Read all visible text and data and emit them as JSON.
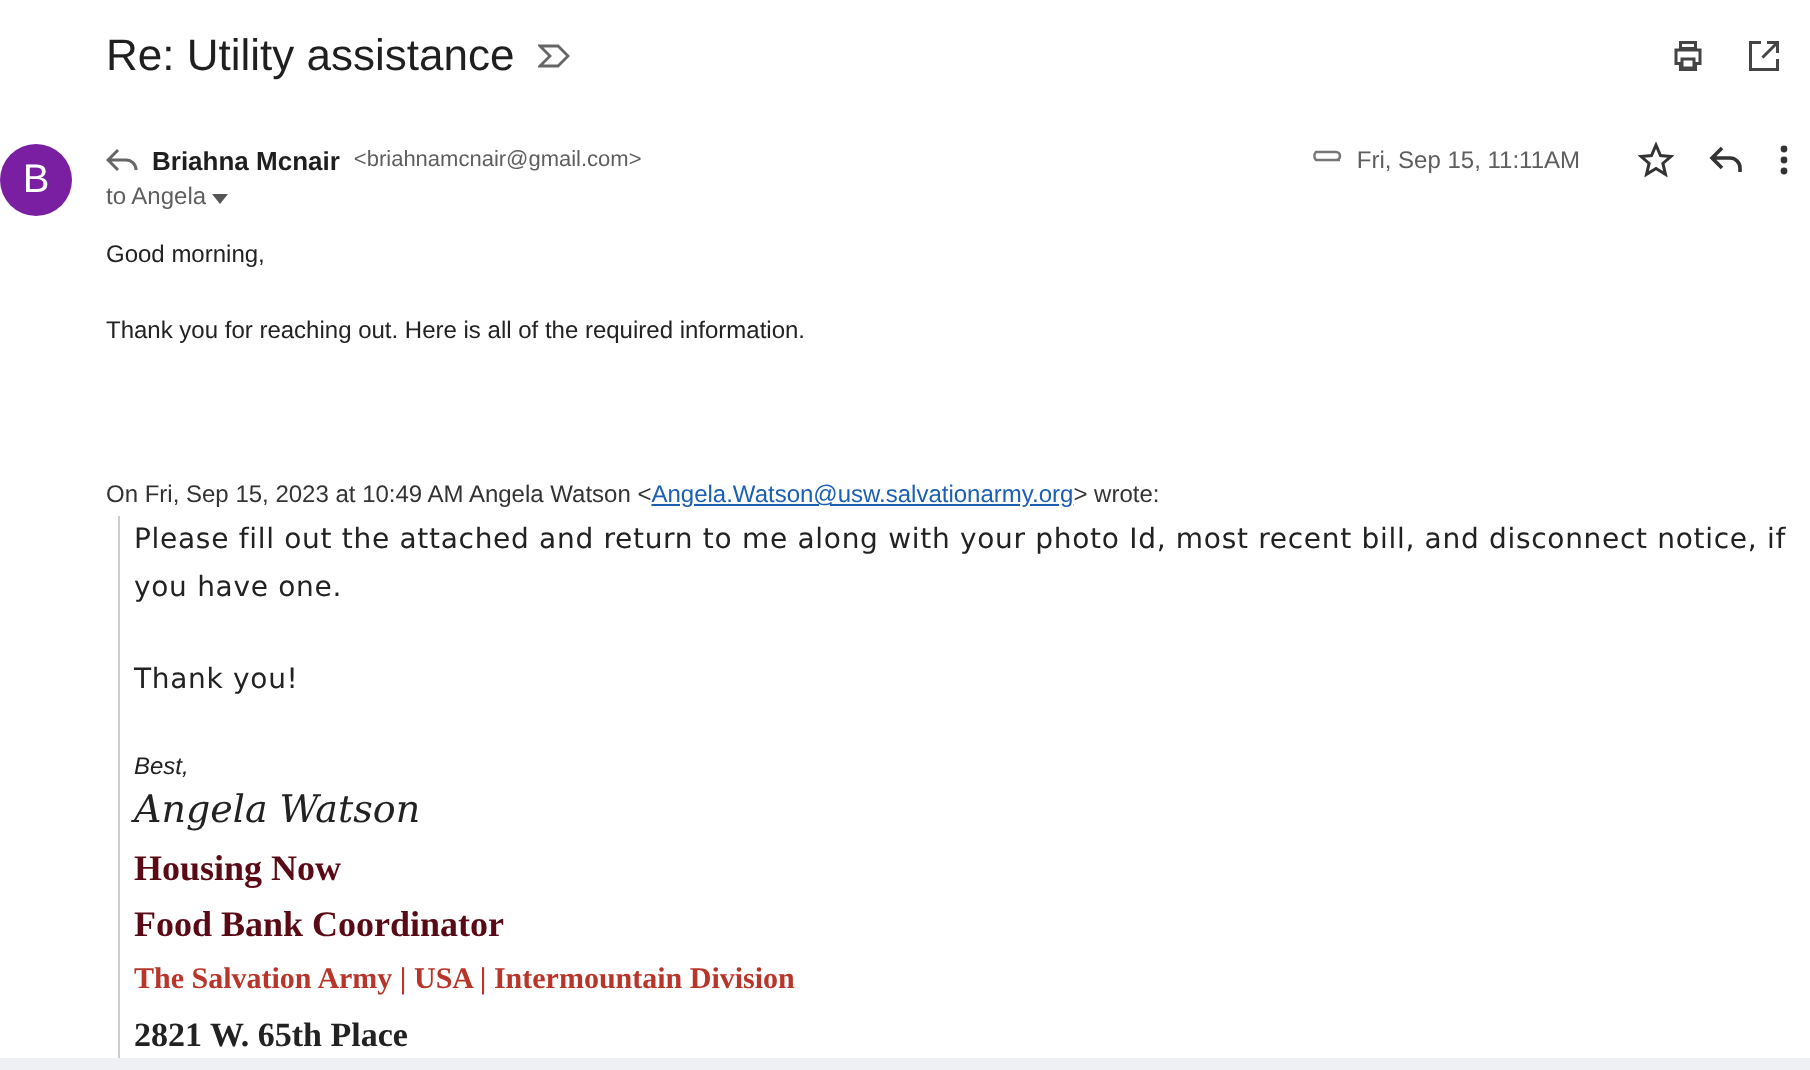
{
  "subject": "Re: Utility assistance",
  "message": {
    "avatar_letter": "B",
    "sender_name": "Briahna Mcnair",
    "sender_email": "<briahnamcnair@gmail.com>",
    "recipient": "to Angela",
    "date": "Fri, Sep 15, 11:11AM",
    "starred": false,
    "has_attachment": true
  },
  "body": [
    "Good morning,",
    "Thank you for reaching out. Here is all of the required information."
  ],
  "quote": {
    "intro_before": "On Fri, Sep 15, 2023 at 10:49 AM Angela Watson <",
    "intro_link": "Angela.Watson@usw.salvationarmy.org",
    "intro_after": "> wrote:",
    "text": "Please fill out the attached and return to me along with your photo Id, most recent bill, and disconnect notice, if you have one.",
    "thanks": "Thank you!",
    "closing": "Best,",
    "signature_name": "Angela Watson",
    "signature_lines": [
      {
        "text": "Housing Now",
        "kind": "title"
      },
      {
        "text": "Food Bank Coordinator",
        "kind": "title"
      },
      {
        "text": "The Salvation Army | USA | Intermountain Division",
        "kind": "org"
      },
      {
        "text": "2821 W. 65th Place",
        "kind": "address"
      }
    ]
  }
}
